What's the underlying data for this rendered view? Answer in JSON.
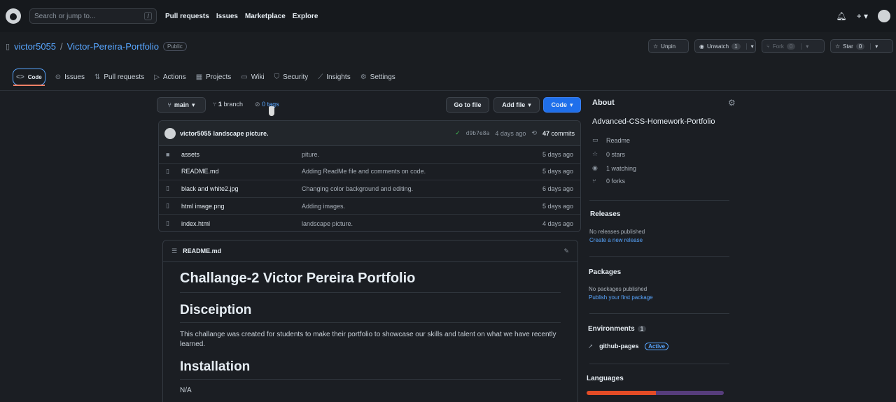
{
  "topbar": {
    "search_placeholder": "Search or jump to...",
    "search_shortcut": "/",
    "nav": [
      "Pull requests",
      "Issues",
      "Marketplace",
      "Explore"
    ],
    "icons": [
      "bell-icon",
      "plus-icon",
      "avatar"
    ]
  },
  "repo": {
    "owner": "victor5055",
    "separator": "/",
    "name": "Victor-Pereira-Portfolio",
    "visibility": "Public",
    "unpin": "Unpin",
    "unwatch": "Unwatch",
    "watch_count": "1",
    "fork": "Fork",
    "fork_count": "0",
    "star": "Star",
    "star_count": "0"
  },
  "tabs": [
    {
      "label": "Code",
      "icon": "code-icon",
      "active": true
    },
    {
      "label": "Issues",
      "icon": "issue-icon"
    },
    {
      "label": "Pull requests",
      "icon": "pr-icon"
    },
    {
      "label": "Actions",
      "icon": "actions-icon"
    },
    {
      "label": "Projects",
      "icon": "projects-icon"
    },
    {
      "label": "Wiki",
      "icon": "wiki-icon"
    },
    {
      "label": "Security",
      "icon": "shield-icon"
    },
    {
      "label": "Insights",
      "icon": "graph-icon"
    },
    {
      "label": "Settings",
      "icon": "gear-icon"
    }
  ],
  "branch": {
    "current": "main",
    "branches_count": "1",
    "branches_label": "branch",
    "tags_label": "0 tags",
    "go_to_file": "Go to file",
    "add_file": "Add file",
    "code": "Code"
  },
  "commit": {
    "author": "victor5055",
    "message": "landscape picture.",
    "sha": "d9b7e8a",
    "when": "4 days ago",
    "count": "47",
    "count_label": "commits"
  },
  "files": [
    {
      "type": "dir",
      "name": "assets",
      "message": "piture.",
      "date": "5 days ago"
    },
    {
      "type": "file",
      "name": "README.md",
      "message": "Adding ReadMe file and comments on code.",
      "date": "5 days ago"
    },
    {
      "type": "file",
      "name": "black and white2.jpg",
      "message": "Changing color background and editing.",
      "date": "6 days ago"
    },
    {
      "type": "file",
      "name": "html image.png",
      "message": "Adding images.",
      "date": "5 days ago"
    },
    {
      "type": "file",
      "name": "index.html",
      "message": "landscape picture.",
      "date": "4 days ago"
    }
  ],
  "readme": {
    "file": "README.md",
    "title": "Challange-2 Victor Pereira Portfolio",
    "h_description": "Disceiption",
    "description": "This challange was created for students to make their portfolio to showcase our skills and talent on what we have recently learned.",
    "h_installation": "Installation",
    "installation": "N/A"
  },
  "sidebar": {
    "about": "About",
    "description": "Advanced-CSS-Homework-Portfolio",
    "readme": "Readme",
    "stars": "0 stars",
    "watching": "1 watching",
    "forks": "0 forks",
    "releases": "Releases",
    "releases_none": "No releases published",
    "releases_link": "Create a new release",
    "packages": "Packages",
    "packages_none": "No packages published",
    "packages_link": "Publish your first package",
    "environments": "Environments",
    "env_count": "1",
    "env_name": "github-pages",
    "env_status": "Active",
    "languages": "Languages",
    "lang_colors": [
      "#e34c26",
      "#563d7c"
    ],
    "lang_split": [
      50.5,
      49.5
    ]
  }
}
